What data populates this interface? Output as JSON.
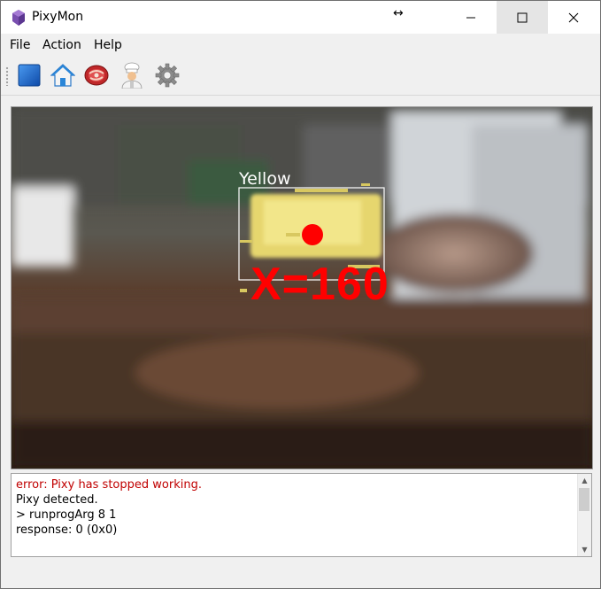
{
  "window": {
    "title": "PixyMon",
    "controls": {
      "minimize_icon": "minimize-icon",
      "maximize_icon": "maximize-icon",
      "close_icon": "close-icon"
    }
  },
  "menu": {
    "items": [
      "File",
      "Action",
      "Help"
    ]
  },
  "toolbar": {
    "buttons": [
      {
        "name": "blue-square-icon",
        "color": "#1e64c8"
      },
      {
        "name": "home-icon",
        "color": "#3a8fd8"
      },
      {
        "name": "raw-meat-icon",
        "color": "#c83232"
      },
      {
        "name": "chef-icon",
        "color": "#e0b080"
      },
      {
        "name": "gear-icon",
        "color": "#8a8a8a"
      }
    ]
  },
  "video": {
    "detection": {
      "label": "Yellow",
      "readout": "X=160",
      "box_color": "#ffffff",
      "marker_color": "#ff0000"
    }
  },
  "console": {
    "lines": [
      {
        "text": "error: Pixy has stopped working.",
        "color": "#c00000"
      },
      {
        "text": "Pixy detected.",
        "color": "#000000"
      },
      {
        "text": "> runprogArg 8 1",
        "color": "#000000"
      },
      {
        "text": "response: 0 (0x0)",
        "color": "#000000"
      }
    ]
  }
}
